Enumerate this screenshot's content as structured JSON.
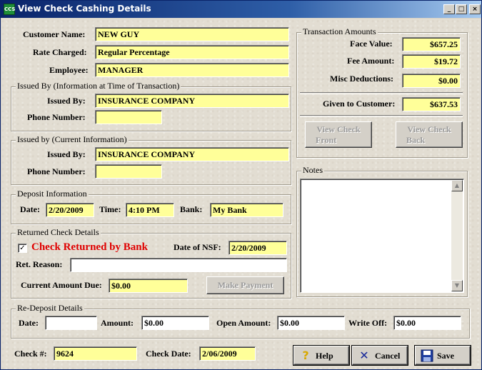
{
  "window": {
    "title": "View Check Cashing Details",
    "app_icon_text": "CCS",
    "minimize": "_",
    "maximize": "□",
    "close": "×"
  },
  "customer": {
    "name_label": "Customer Name:",
    "name": "NEW GUY",
    "rate_label": "Rate Charged:",
    "rate": "Regular Percentage",
    "employee_label": "Employee:",
    "employee": "MANAGER"
  },
  "issued_original": {
    "title": "Issued By (Information at Time of Transaction)",
    "issued_by_label": "Issued By:",
    "issued_by": "INSURANCE COMPANY",
    "phone_label": "Phone Number:",
    "phone": ""
  },
  "issued_current": {
    "title": "Issued by (Current Information)",
    "issued_by_label": "Issued By:",
    "issued_by": "INSURANCE COMPANY",
    "phone_label": "Phone Number:",
    "phone": ""
  },
  "deposit": {
    "title": "Deposit Information",
    "date_label": "Date:",
    "date": "2/20/2009",
    "time_label": "Time:",
    "time": "4:10 PM",
    "bank_label": "Bank:",
    "bank": "My Bank"
  },
  "returned": {
    "title": "Returned Check Details",
    "checked": "✓",
    "check_label": "Check Returned by Bank",
    "nsf_label": "Date of NSF:",
    "nsf_date": "2/20/2009",
    "reason_label": "Ret. Reason:",
    "reason": "",
    "due_label": "Current Amount Due:",
    "due": "$0.00",
    "make_payment": "Make Payment"
  },
  "redeposit": {
    "title": "Re-Deposit Details",
    "date_label": "Date:",
    "date": "",
    "amount_label": "Amount:",
    "amount": "$0.00",
    "open_label": "Open Amount:",
    "open": "$0.00",
    "write_off_label": "Write Off:",
    "write_off": "$0.00"
  },
  "transaction": {
    "title": "Transaction Amounts",
    "face_label": "Face Value:",
    "face": "$657.25",
    "fee_label": "Fee Amount:",
    "fee": "$19.72",
    "misc_label": "Misc Deductions:",
    "misc": "$0.00",
    "given_label": "Given to Customer:",
    "given": "$637.53",
    "view_front_1": "View Check",
    "view_front_2": "Front",
    "view_back_1": "View Check",
    "view_back_2": "Back"
  },
  "notes": {
    "title": "Notes",
    "text": ""
  },
  "footer": {
    "check_no_label": "Check #:",
    "check_no": "9624",
    "check_date_label": "Check Date:",
    "check_date": "2/06/2009",
    "help": "Help",
    "cancel": "Cancel",
    "save": "Save"
  }
}
